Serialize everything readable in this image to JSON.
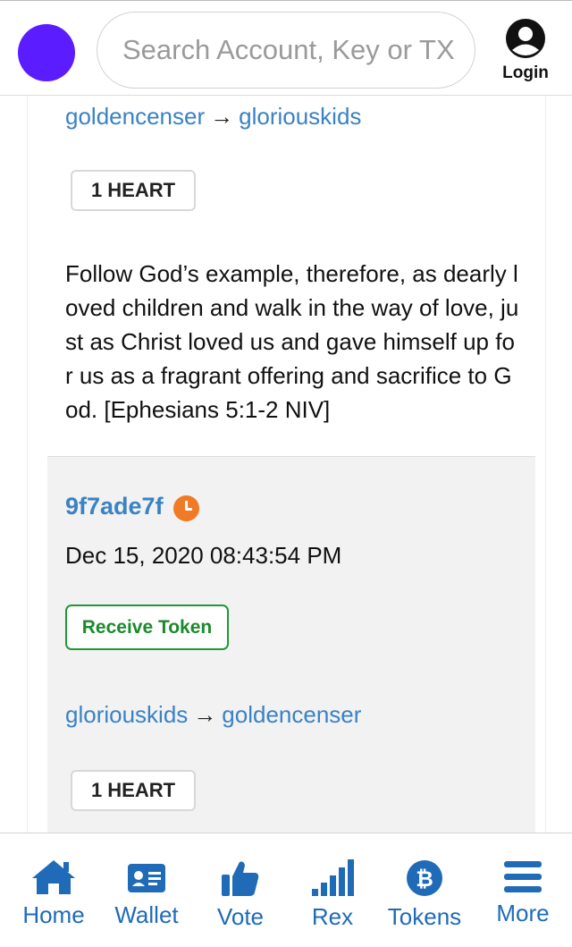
{
  "header": {
    "search_placeholder": "Search Account, Key or TX",
    "login_label": "Login"
  },
  "colors": {
    "logo": "#5b1cff",
    "link": "#3a82c4",
    "nav": "#1f6bb8",
    "pending_icon": "#f07a26",
    "action_green": "#1b8a2b"
  },
  "card": {
    "first_transfer": {
      "from": "goldencenser",
      "arrow": "→",
      "to": "gloriouskids",
      "quantity": "1 HEART",
      "memo": "Follow God’s example, therefore, as dearly loved children and walk in the way of love, just as Christ loved us and gave himself up for us as a fragrant offering and sacrifice to God. [Ephesians 5:1-2 NIV]"
    },
    "transaction": {
      "id": "9f7ade7f",
      "status_icon": "clock-icon",
      "date": "Dec 15, 2020 08:43:54 PM",
      "action": "Receive Token",
      "from": "gloriouskids",
      "arrow": "→",
      "to": "goldencenser",
      "quantity": "1 HEART"
    }
  },
  "nav": {
    "items": [
      {
        "label": "Home",
        "icon": "home-icon"
      },
      {
        "label": "Wallet",
        "icon": "wallet-icon"
      },
      {
        "label": "Vote",
        "icon": "thumbs-up-icon"
      },
      {
        "label": "Rex",
        "icon": "signal-bars-icon"
      },
      {
        "label": "Tokens",
        "icon": "bitcoin-icon"
      },
      {
        "label": "More",
        "icon": "menu-icon"
      }
    ]
  }
}
